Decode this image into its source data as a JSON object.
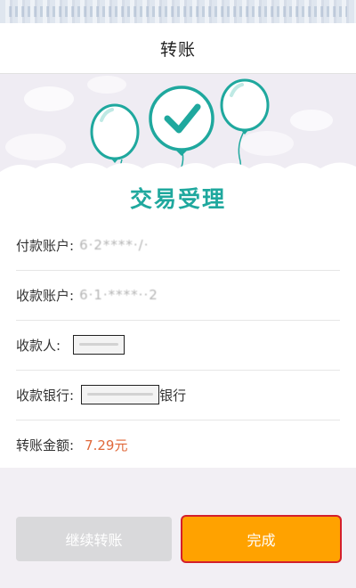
{
  "header": {
    "title": "转账"
  },
  "banner": {
    "status_text": "交易受理"
  },
  "details": {
    "payer_label": "付款账户:",
    "payer_value": "6·2****·/·",
    "payee_account_label": "收款账户:",
    "payee_account_value": "6·1·****··2",
    "payee_name_label": "收款人:",
    "bank_label": "收款银行:",
    "bank_suffix": "银行",
    "amount_label": "转账金额:",
    "amount_value": "7.29元"
  },
  "actions": {
    "continue_label": "继续转账",
    "done_label": "完成"
  },
  "colors": {
    "accent_teal": "#1fa89e",
    "done_orange": "#ffa200",
    "amount_orange": "#e0683a",
    "disabled_gray": "#d9d9db"
  },
  "icons": [
    "balloon-icon",
    "check-icon"
  ]
}
